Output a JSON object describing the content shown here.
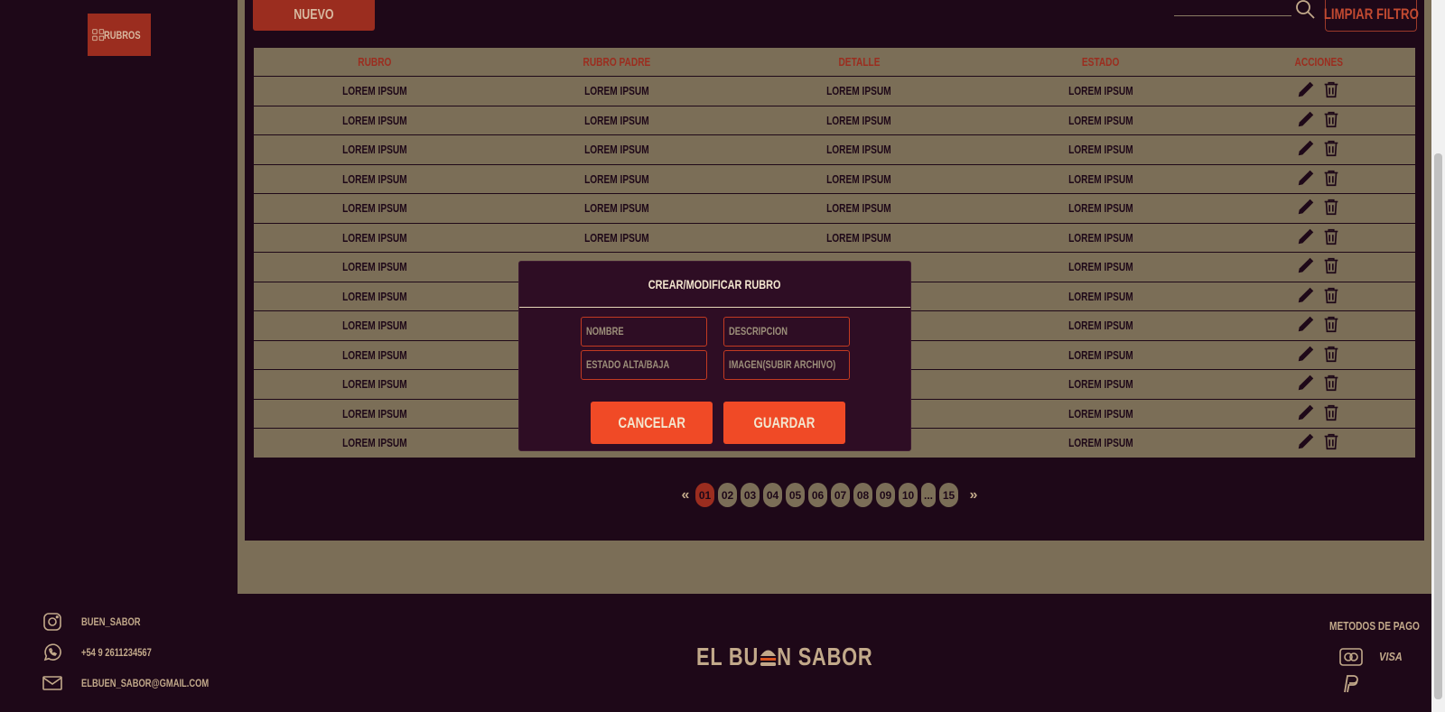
{
  "sidebar": {
    "items": [
      {
        "label": "RUBROS",
        "icon": "grid-icon"
      }
    ]
  },
  "toolbar": {
    "new_label": "NUEVO",
    "clear_filter_label": "LIMPIAR FILTRO",
    "search_placeholder": ""
  },
  "table": {
    "headers": [
      "RUBRO",
      "RUBRO PADRE",
      "DETALLE",
      "ESTADO",
      "ACCIONES"
    ],
    "rows": [
      [
        "LOREM IPSUM",
        "LOREM IPSUM",
        "LOREM IPSUM",
        "LOREM IPSUM"
      ],
      [
        "LOREM IPSUM",
        "LOREM IPSUM",
        "LOREM IPSUM",
        "LOREM IPSUM"
      ],
      [
        "LOREM IPSUM",
        "LOREM IPSUM",
        "LOREM IPSUM",
        "LOREM IPSUM"
      ],
      [
        "LOREM IPSUM",
        "LOREM IPSUM",
        "LOREM IPSUM",
        "LOREM IPSUM"
      ],
      [
        "LOREM IPSUM",
        "LOREM IPSUM",
        "LOREM IPSUM",
        "LOREM IPSUM"
      ],
      [
        "LOREM IPSUM",
        "LOREM IPSUM",
        "LOREM IPSUM",
        "LOREM IPSUM"
      ],
      [
        "LOREM IPSUM",
        "",
        "",
        "LOREM IPSUM"
      ],
      [
        "LOREM IPSUM",
        "",
        "",
        "LOREM IPSUM"
      ],
      [
        "LOREM IPSUM",
        "",
        "",
        "LOREM IPSUM"
      ],
      [
        "LOREM IPSUM",
        "",
        "",
        "LOREM IPSUM"
      ],
      [
        "LOREM IPSUM",
        "",
        "",
        "LOREM IPSUM"
      ],
      [
        "LOREM IPSUM",
        "",
        "",
        "LOREM IPSUM"
      ],
      [
        "LOREM IPSUM",
        "",
        "",
        "LOREM IPSUM"
      ]
    ]
  },
  "pagination": {
    "prev": "«",
    "next": "»",
    "pages": [
      "01",
      "02",
      "03",
      "04",
      "05",
      "06",
      "07",
      "08",
      "09",
      "10",
      "...",
      "15"
    ],
    "active": "01"
  },
  "modal": {
    "title": "CREAR/MODIFICAR RUBRO",
    "fields": {
      "nombre": "NOMBRE",
      "descripcion": "DESCRIPCION",
      "estado": "ESTADO ALTA/BAJA",
      "imagen": "IMAGEN(SUBIR ARCHIVO)"
    },
    "cancel_label": "CANCELAR",
    "save_label": "GUARDAR"
  },
  "footer": {
    "instagram": "BUEN_SABOR",
    "whatsapp": "+54 9 2611234567",
    "email": "ELBUEN_SABOR@GMAIL.COM",
    "brand_left": "EL BU",
    "brand_right": "N SABOR",
    "payment_title": "METODOS DE PAGO",
    "payment_visa": "VISA"
  },
  "colors": {
    "background": "#1e0818",
    "panel_tan": "#7b6e57",
    "accent_red": "#9b2d1f",
    "button_orange": "#f04a26",
    "modal_bg": "#2e0d24"
  }
}
